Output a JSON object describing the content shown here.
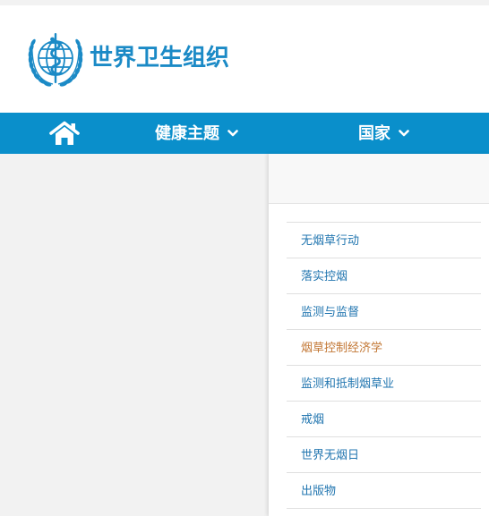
{
  "colors": {
    "brand_blue": "#0a8fcb",
    "title_blue": "#1b8ac6",
    "link_blue": "#2276b0",
    "active_orange": "#c27633",
    "panel_gray": "#f2f2f2"
  },
  "header": {
    "logo_icon": "who-emblem-icon",
    "title": "世界卫生组织"
  },
  "nav": {
    "home_icon": "home-icon",
    "items": [
      {
        "label": "健康主题",
        "icon": "chevron-down-icon"
      },
      {
        "label": "国家",
        "icon": "chevron-down-icon"
      }
    ]
  },
  "submenu": {
    "items": [
      {
        "label": "无烟草行动",
        "active": false
      },
      {
        "label": "落实控烟",
        "active": false
      },
      {
        "label": "监测与监督",
        "active": false
      },
      {
        "label": "烟草控制经济学",
        "active": true
      },
      {
        "label": "监测和抵制烟草业",
        "active": false
      },
      {
        "label": "戒烟",
        "active": false
      },
      {
        "label": "世界无烟日",
        "active": false
      },
      {
        "label": "出版物",
        "active": false
      }
    ]
  }
}
